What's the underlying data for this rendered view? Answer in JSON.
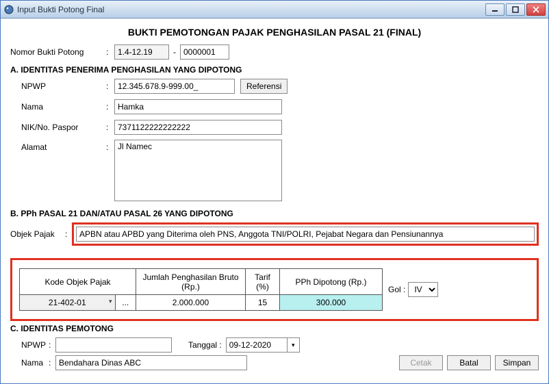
{
  "window": {
    "title": "Input Bukti Potong Final",
    "minimize": "—",
    "maximize": "▢",
    "close": "✕"
  },
  "page_title": "BUKTI PEMOTONGAN PAJAK PENGHASILAN PASAL 21 (FINAL)",
  "nomor": {
    "label": "Nomor Bukti Potong",
    "part1": "1.4-12.19",
    "sep": "-",
    "part2": "0000001"
  },
  "section_a": {
    "header": "A. IDENTITAS PENERIMA PENGHASILAN YANG DIPOTONG",
    "npwp_label": "NPWP",
    "npwp_value": "12.345.678.9-999.00_",
    "referensi": "Referensi",
    "nama_label": "Nama",
    "nama_value": "Hamka",
    "nik_label": "NIK/No. Paspor",
    "nik_value": "7371122222222222",
    "alamat_label": "Alamat",
    "alamat_value": "Jl Namec"
  },
  "section_b": {
    "header": "B. PPh PASAL 21 DAN/ATAU PASAL 26 YANG DIPOTONG",
    "objek_label": "Objek Pajak",
    "objek_value": "APBN atau APBD yang Diterima oleh PNS, Anggota TNI/POLRI, Pejabat Negara dan Pensiunannya",
    "col_kode": "Kode Objek Pajak",
    "col_bruto": "Jumlah Penghasilan Bruto (Rp.)",
    "col_tarif": "Tarif (%)",
    "col_dipotong": "PPh Dipotong (Rp.)",
    "row": {
      "kode": "21-402-01",
      "dots": "...",
      "bruto": "2.000.000",
      "tarif": "15",
      "dipotong": "300.000"
    },
    "gol_label": "Gol :",
    "gol_value": "IV"
  },
  "section_c": {
    "header": "C. IDENTITAS PEMOTONG",
    "npwp_label": "NPWP",
    "npwp_value": "",
    "tanggal_label": "Tanggal :",
    "tanggal_value": "09-12-2020",
    "nama_label": "Nama",
    "nama_value": "Bendahara Dinas ABC"
  },
  "buttons": {
    "cetak": "Cetak",
    "batal": "Batal",
    "simpan": "Simpan"
  }
}
